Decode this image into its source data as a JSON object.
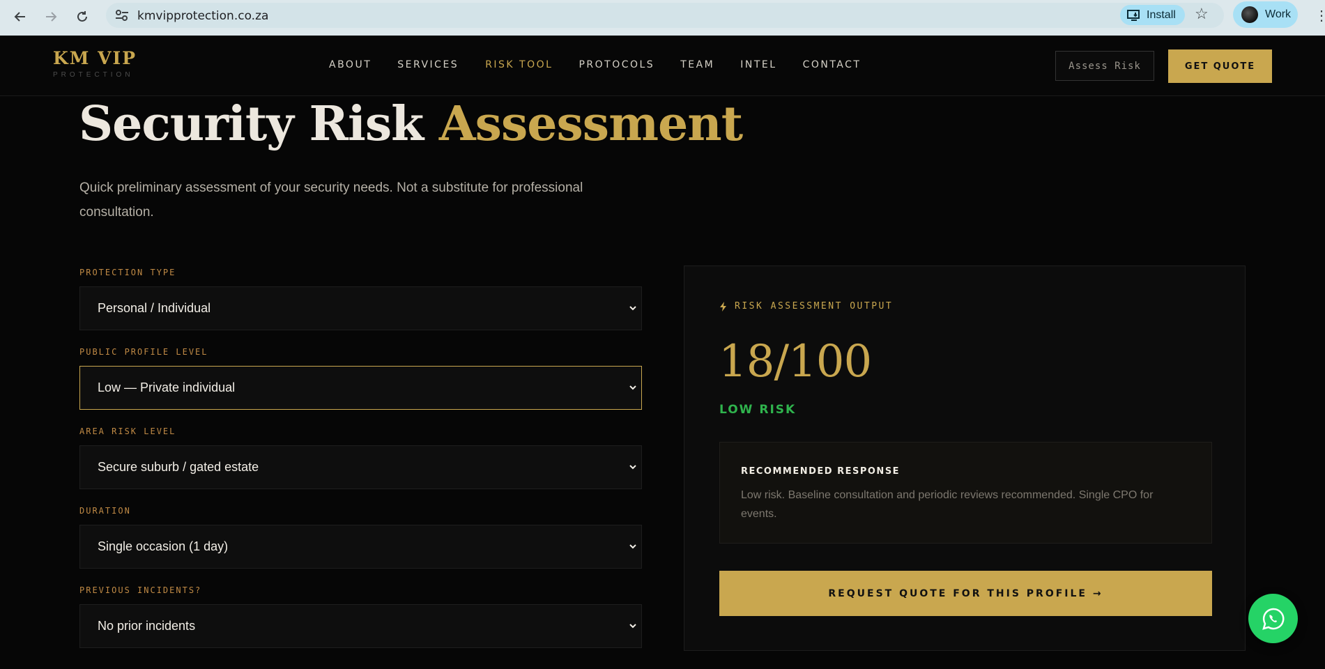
{
  "browser": {
    "url": "kmvipprotection.co.za",
    "install_label": "Install",
    "profile_label": "Work"
  },
  "header": {
    "logo_main": "KM VIP",
    "logo_sub": "PROTECTION",
    "nav": [
      "ABOUT",
      "SERVICES",
      "RISK TOOL",
      "PROTOCOLS",
      "TEAM",
      "INTEL",
      "CONTACT"
    ],
    "active_nav": "RISK TOOL",
    "assess_label": "Assess Risk",
    "quote_label": "GET QUOTE"
  },
  "hero": {
    "title_part1": "Security Risk",
    "title_part2": "Assessment",
    "subtitle": "Quick preliminary assessment of your security needs. Not a substitute for professional consultation."
  },
  "form": {
    "fields": [
      {
        "label": "PROTECTION TYPE",
        "value": "Personal / Individual"
      },
      {
        "label": "PUBLIC PROFILE LEVEL",
        "value": "Low — Private individual"
      },
      {
        "label": "AREA RISK LEVEL",
        "value": "Secure suburb / gated estate"
      },
      {
        "label": "DURATION",
        "value": "Single occasion (1 day)"
      },
      {
        "label": "PREVIOUS INCIDENTS?",
        "value": "No prior incidents"
      }
    ]
  },
  "output": {
    "kicker": "RISK ASSESSMENT OUTPUT",
    "score": "18/100",
    "risk_level": "LOW RISK",
    "recommendation_heading": "RECOMMENDED RESPONSE",
    "recommendation_body": "Low risk. Baseline consultation and periodic reviews recommended. Single CPO for events.",
    "cta_label": "REQUEST QUOTE FOR THIS PROFILE →"
  },
  "colors": {
    "accent_gold": "#c9a74f",
    "label_amber": "#c08a45",
    "risk_green": "#2fb34d",
    "whatsapp_green": "#25d366"
  }
}
